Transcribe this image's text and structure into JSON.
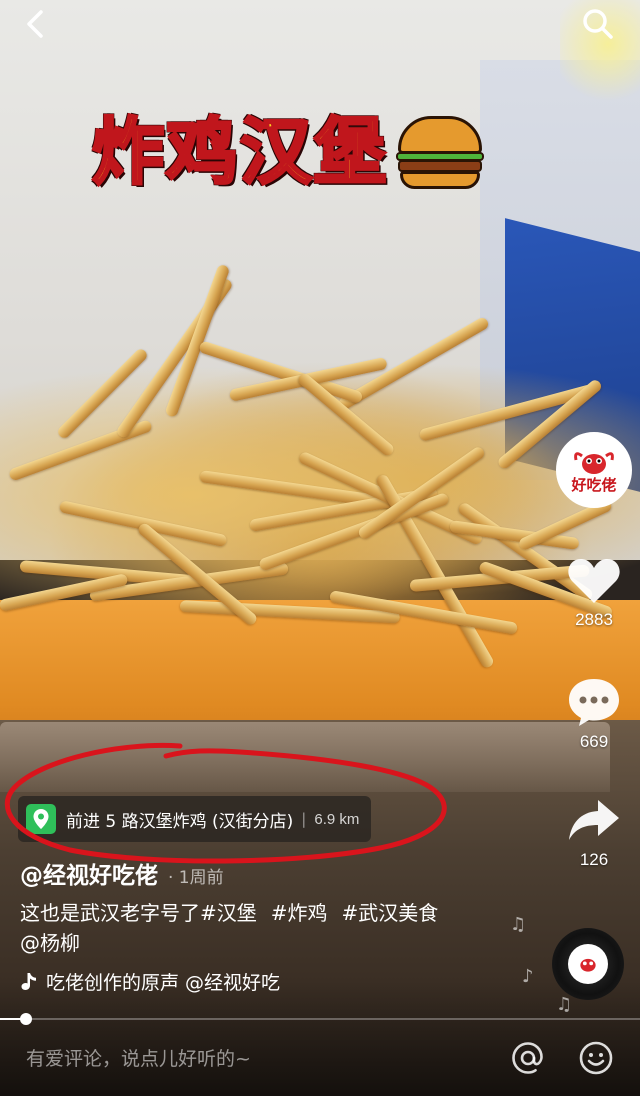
{
  "video": {
    "overlay_title": "炸鸡汉堡"
  },
  "nav": {
    "back_icon": "chevron-left-icon",
    "search_icon": "search-icon"
  },
  "creator": {
    "avatar_text": "好吃佬"
  },
  "actions": {
    "likes": "2883",
    "comments": "669",
    "shares": "126"
  },
  "location": {
    "name": "前进 5 路汉堡炸鸡 (汉街分店)",
    "distance": "6.9 km"
  },
  "post": {
    "author": "@经视好吃佬",
    "time": "· 1周前",
    "caption": "这也是武汉老字号了",
    "hashtags": [
      "#汉堡",
      "#炸鸡",
      "#武汉美食"
    ],
    "mention": "@杨柳",
    "music": "吃佬创作的原声  @经视好吃"
  },
  "playback": {
    "progress": 0.04
  },
  "comment_input": {
    "placeholder": "有爱评论，说点儿好听的~"
  },
  "colors": {
    "location_pin": "#2fbf5a",
    "annotation_red": "#d9141c",
    "title_yellow": "#ffd21f"
  }
}
